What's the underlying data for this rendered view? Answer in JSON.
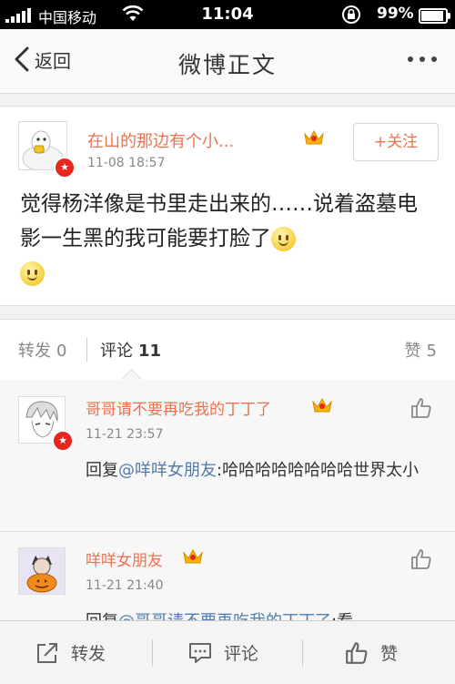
{
  "status_bar": {
    "carrier": "中国移动",
    "time": "11:04",
    "battery": "99%",
    "battery_level": 0.99,
    "icons": [
      "signal-icon",
      "wifi-icon",
      "rotation-lock-icon",
      "battery-icon"
    ]
  },
  "nav": {
    "back_label": "返回",
    "title": "微博正文",
    "icons": [
      "back-chevron-icon",
      "more-icon"
    ]
  },
  "post": {
    "username": "在山的那边有个小...",
    "time": "11-08 18:57",
    "follow_label": "+关注",
    "text": "觉得杨洋像是书里走出来的……说着盗墓电影一生黑的我可能要打脸了",
    "verified_badge": "v-badge-icon",
    "member_badge": "crown-icon",
    "emoji": [
      "smiley-icon",
      "smiley-icon"
    ]
  },
  "tabs": {
    "forward_label": "转发",
    "forward_count": "0",
    "comment_label": "评论",
    "comment_count": "11",
    "like_label": "赞",
    "like_count": "5"
  },
  "comments": [
    {
      "username": "哥哥请不要再吃我的丁丁了",
      "time": "11-21 23:57",
      "reply_prefix": "回复",
      "mention": "@咩咩女朋友",
      "text": ":哈哈哈哈哈哈哈哈世界太小"
    },
    {
      "username": "咩咩女朋友",
      "time": "11-21 21:40",
      "reply_prefix": "回复",
      "mention": "@哥哥请不要再吃我的丁丁了",
      "text": ":看"
    }
  ],
  "bottom_bar": {
    "forward_label": "转发",
    "comment_label": "评论",
    "like_label": "赞"
  },
  "colors": {
    "accent": "#eb7350",
    "mention": "#4f7cae",
    "verified": "#e6261f"
  }
}
